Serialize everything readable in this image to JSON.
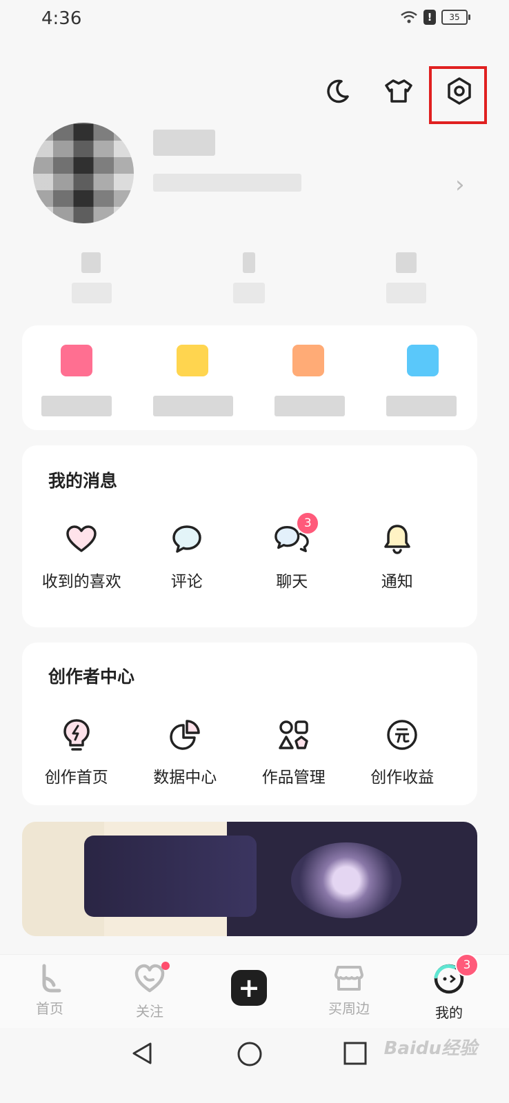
{
  "status_bar": {
    "time": "4:36",
    "battery": "35"
  },
  "top_icons": [
    "moon-icon",
    "shirt-icon",
    "settings-icon"
  ],
  "messages": {
    "title": "我的消息",
    "items": [
      {
        "label": "收到的喜欢",
        "icon": "heart-icon"
      },
      {
        "label": "评论",
        "icon": "comment-icon"
      },
      {
        "label": "聊天",
        "icon": "chat-icon",
        "badge": "3"
      },
      {
        "label": "通知",
        "icon": "bell-icon"
      }
    ]
  },
  "creator": {
    "title": "创作者中心",
    "items": [
      {
        "label": "创作首页",
        "icon": "lightbulb-icon"
      },
      {
        "label": "数据中心",
        "icon": "pie-chart-icon"
      },
      {
        "label": "作品管理",
        "icon": "shapes-icon"
      },
      {
        "label": "创作收益",
        "icon": "yuan-icon"
      }
    ]
  },
  "bottom_nav": {
    "items": [
      {
        "label": "首页",
        "icon": "home-icon"
      },
      {
        "label": "关注",
        "icon": "follow-icon"
      },
      {
        "label": "",
        "icon": "plus-icon"
      },
      {
        "label": "买周边",
        "icon": "shop-icon"
      },
      {
        "label": "我的",
        "icon": "me-icon",
        "badge": "3"
      }
    ]
  },
  "watermark": "Baidu经验",
  "accent_color": "#ff5a7a"
}
